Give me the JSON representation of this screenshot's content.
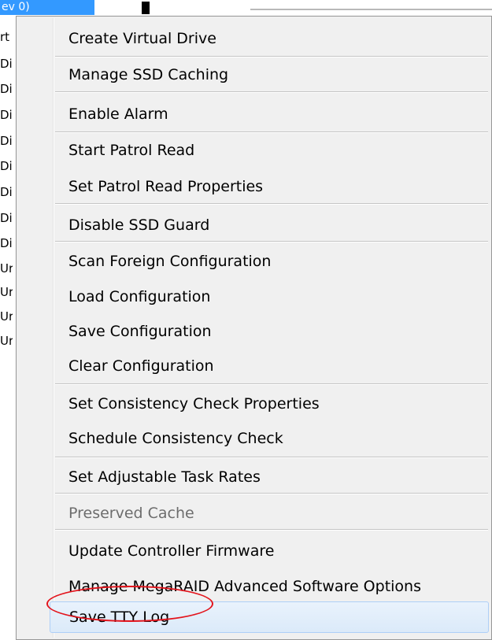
{
  "background": {
    "selected_text": "ev 0)",
    "fragments": [
      "rt",
      "Di",
      "Di",
      "Di",
      "Di",
      "Di",
      "Di",
      "Di",
      "Di",
      "Ur",
      "Ur",
      "Ur",
      "Ur"
    ]
  },
  "menu": {
    "items": [
      {
        "label": "Create Virtual Drive"
      },
      {
        "label": "Manage SSD Caching"
      },
      {
        "label": "Enable Alarm"
      },
      {
        "label": "Start Patrol Read"
      },
      {
        "label": "Set Patrol Read Properties"
      },
      {
        "label": "Disable SSD Guard"
      },
      {
        "label": "Scan Foreign Configuration"
      },
      {
        "label": "Load Configuration"
      },
      {
        "label": "Save Configuration"
      },
      {
        "label": "Clear Configuration"
      },
      {
        "label": "Set Consistency Check Properties"
      },
      {
        "label": "Schedule Consistency Check"
      },
      {
        "label": "Set Adjustable Task Rates"
      },
      {
        "label": "Preserved Cache",
        "disabled": true
      },
      {
        "label": "Update Controller Firmware"
      },
      {
        "label": "Manage MegaRAID Advanced Software Options"
      },
      {
        "label": "Save TTY Log",
        "highlighted": true
      }
    ],
    "annotation_color": "#e3141c"
  }
}
